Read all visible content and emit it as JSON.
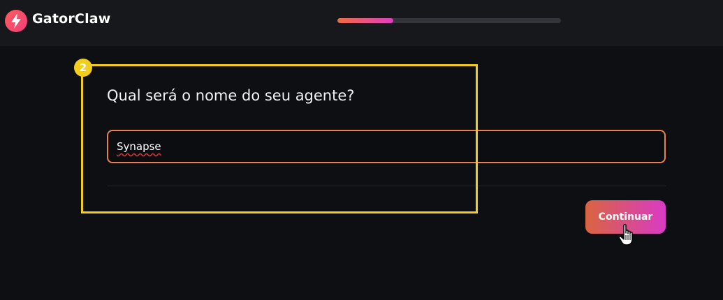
{
  "header": {
    "brand": "GatorClaw",
    "logo_icon": "lightning-icon",
    "progress": 0.25
  },
  "step": {
    "number": "2",
    "question": "Qual será o nome do seu agente?",
    "input_value": "Synapse"
  },
  "actions": {
    "continue_label": "Continuar"
  },
  "colors": {
    "background": "#0e0f12",
    "topbar": "#17181c",
    "accent_orange": "#e9814f",
    "accent_pink": "#d93bc4",
    "highlight": "#f2cd1c"
  }
}
